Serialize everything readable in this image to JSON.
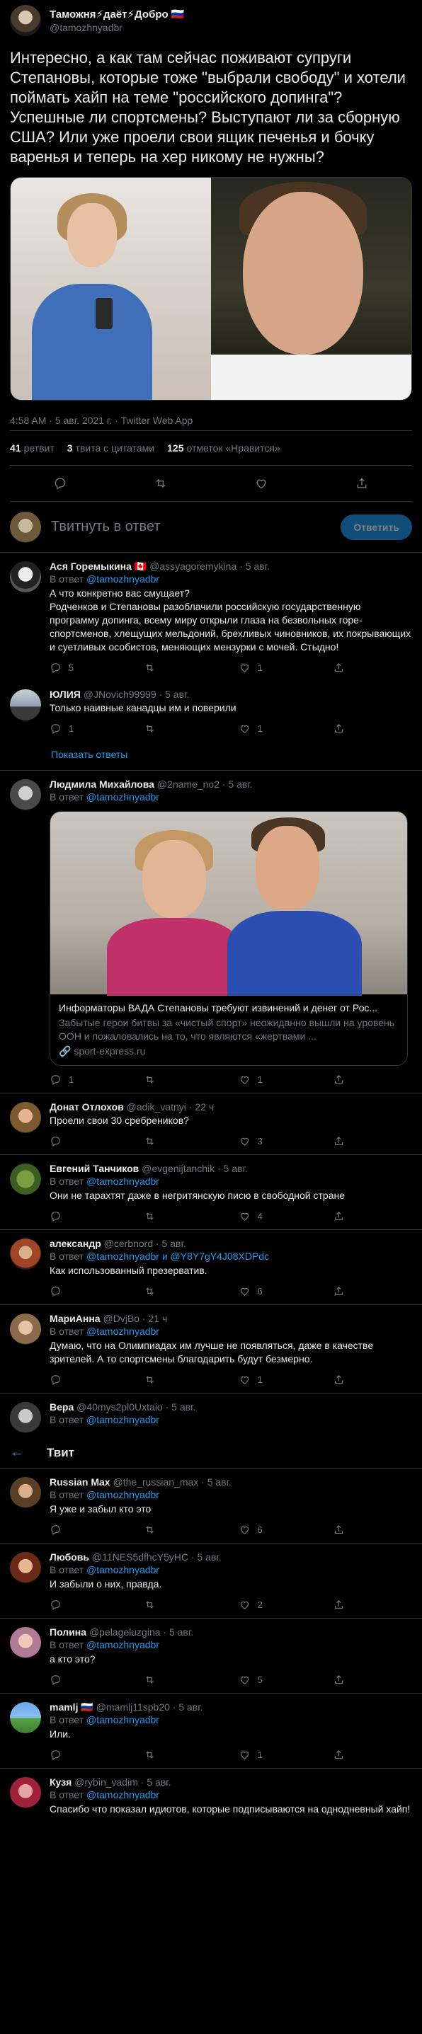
{
  "main_tweet": {
    "display_name": "Таможня⚡даёт⚡Добро 🇷🇺",
    "handle": "@tamozhnyadbr",
    "text": "Интересно, а как там сейчас поживают супруги Степановы, которые тоже \"выбрали свободу\" и хотели поймать хайп на теме \"российского допинга\"? Успешные ли спортсмены? Выступают ли за сборную США? Или уже проели свои ящик печенья и бочку варенья и теперь на хер никому не нужны?",
    "meta": "4:58 AM · 5 авг. 2021 г. · Twitter Web App",
    "retweets_count": "41",
    "retweets_label": "ретвит",
    "quotes_count": "3",
    "quotes_label": "твита с цитатами",
    "likes_count": "125",
    "likes_label": "отметок «Нравится»"
  },
  "compose": {
    "placeholder": "Твитнуть в ответ",
    "button": "Ответить"
  },
  "sticky_header": {
    "back": "←",
    "title": "Твит"
  },
  "in_reply_prefix": "В ответ",
  "show_replies": "Показать ответы",
  "replies": [
    {
      "name": "Ася Горемыкина 🇨🇦",
      "handle": "@assyagoremykina · 5 авг.",
      "in_reply_to": "@tamozhnyadbr",
      "text": "А что конкретно вас смущает?\nРодченков и Степановы разоблачили российскую государственную программу допинга, всему миру открыли глаза на безвольных горе-спортсменов, хлещущих мельдоний, брехливых чиновников, их покрывающих и суетливых особистов, меняющих мензурки с мочей. Стыдно!",
      "replies": "5",
      "retweets": "",
      "likes": "1"
    },
    {
      "name": "ЮЛИЯ",
      "handle": "@JNovich99999 · 5 авг.",
      "in_reply_to": "",
      "text": "Только наивные канадцы им и поверили",
      "replies": "1",
      "retweets": "",
      "likes": "1"
    },
    {
      "name": "Людмила Михайлова",
      "handle": "@2name_no2 · 5 авг.",
      "in_reply_to": "@tamozhnyadbr",
      "text": "",
      "replies": "1",
      "retweets": "",
      "likes": "1"
    },
    {
      "name": "Донат Отлохов",
      "handle": "@adik_vatnyi · 22 ч",
      "in_reply_to": "",
      "text": "Проели свои 30 сребреников?",
      "replies": "",
      "retweets": "",
      "likes": "3"
    },
    {
      "name": "Евгений Танчиков",
      "handle": "@evgenijtanchik · 5 авг.",
      "in_reply_to": "@tamozhnyadbr",
      "text": "Они не тарахтят даже в негритянскую писю в свободной стране",
      "replies": "",
      "retweets": "",
      "likes": "4"
    },
    {
      "name": "александр",
      "handle": "@cerbnord · 5 авг.",
      "in_reply_to": "@tamozhnyadbr и @Y8Y7gY4J08XDPdc",
      "text": "Как использованный презерватив.",
      "replies": "",
      "retweets": "",
      "likes": "6"
    },
    {
      "name": "МариАнна",
      "handle": "@DvjBo · 21 ч",
      "in_reply_to": "@tamozhnyadbr",
      "text": "Думаю, что на Олимпиадах им лучше не появляться, даже в качестве зрителей. А то спортсмены благодарить будут безмерно.",
      "replies": "",
      "retweets": "",
      "likes": "1"
    },
    {
      "name": "Вера",
      "handle": "@40mys2pl0Uxtaio · 5 авг.",
      "in_reply_to": "@tamozhnyadbr",
      "text": "",
      "replies": "",
      "retweets": "",
      "likes": ""
    },
    {
      "name": "Russian Max",
      "handle": "@the_russian_max · 5 авг.",
      "in_reply_to": "@tamozhnyadbr",
      "text": "Я уже и забыл кто это",
      "replies": "",
      "retweets": "",
      "likes": "6"
    },
    {
      "name": "Любовь",
      "handle": "@11NES5dfhcY5yHC · 5 авг.",
      "in_reply_to": "@tamozhnyadbr",
      "text": "И забыли о них, правда.",
      "replies": "",
      "retweets": "",
      "likes": "2"
    },
    {
      "name": "Полина",
      "handle": "@pelageluzgina · 5 авг.",
      "in_reply_to": "@tamozhnyadbr",
      "text": "а кто это?",
      "replies": "",
      "retweets": "",
      "likes": "5"
    },
    {
      "name": "mamlj 🇷🇺",
      "handle": "@mamlj11spb20 · 5 авг.",
      "in_reply_to": "@tamozhnyadbr",
      "text": "Или.",
      "replies": "",
      "retweets": "",
      "likes": "1"
    },
    {
      "name": "Кузя",
      "handle": "@rybin_vadim · 5 авг.",
      "in_reply_to": "@tamozhnyadbr",
      "text": "Спасибо что показал идиотов, которые подписываются на однодневный хайп!",
      "replies": "",
      "retweets": "",
      "likes": ""
    }
  ],
  "link_card": {
    "title": "Информаторы ВАДА Степановы требуют извинений и денег от Рос...",
    "description": "Забытые герои битвы за «чистый спорт» неожиданно вышли на уровень ООН и пожаловались на то, что являются «жертвами ...",
    "domain": "🔗 sport-express.ru"
  },
  "colors": {
    "background": "#000000",
    "text": "#e7e9ea",
    "muted": "#71767b",
    "accent": "#1d9bf0",
    "divider": "#2f3336"
  }
}
